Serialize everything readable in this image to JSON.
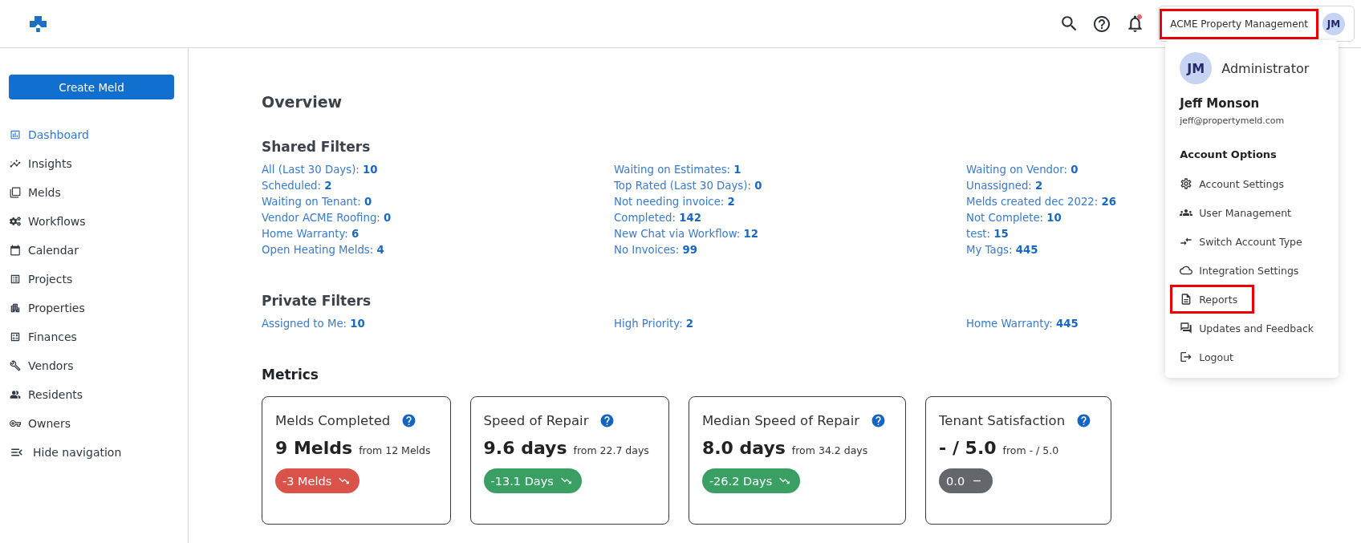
{
  "header": {
    "notifications_unread": true,
    "account": {
      "name": "ACME Property Management",
      "highlighted": true,
      "avatar_initials": "JM"
    }
  },
  "sidebar": {
    "create_button": "Create Meld",
    "items": [
      {
        "label": "Dashboard",
        "selected": true
      },
      {
        "label": "Insights",
        "selected": false
      },
      {
        "label": "Melds",
        "selected": false
      },
      {
        "label": "Workflows",
        "selected": false
      },
      {
        "label": "Calendar",
        "selected": false
      },
      {
        "label": "Projects",
        "selected": false
      },
      {
        "label": "Properties",
        "selected": false
      },
      {
        "label": "Finances",
        "selected": false
      },
      {
        "label": "Vendors",
        "selected": false
      },
      {
        "label": "Residents",
        "selected": false
      },
      {
        "label": "Owners",
        "selected": false
      }
    ],
    "hide_navigation": "Hide navigation"
  },
  "overview": {
    "title": "Overview",
    "sections": [
      {
        "title": "Shared Filters",
        "columns": [
          [
            {
              "text": "All (Last 30 Days): **10**"
            },
            {
              "text": "Scheduled: **2**"
            },
            {
              "text": "Waiting on Tenant: **0**"
            },
            {
              "text": "Vendor ACME Roofing: **0**"
            },
            {
              "text": "Home Warranty: **6**"
            },
            {
              "text": "Open Heating Melds: **4**"
            }
          ],
          [
            {
              "text": "Waiting on Estimates: **1**"
            },
            {
              "text": "Top Rated (Last 30 Days): **0**"
            },
            {
              "text": "Not needing invoice: **2**"
            },
            {
              "text": "Completed: **142**"
            },
            {
              "text": "New Chat via Workflow: **12**"
            },
            {
              "text": "No Invoices: **99**"
            }
          ],
          [
            {
              "text": "Waiting on Vendor: **0**"
            },
            {
              "text": "Unassigned: **2**"
            },
            {
              "text": "Melds created dec 2022: **26**"
            },
            {
              "text": "Not Complete: **10**"
            },
            {
              "text": "test: **15**"
            },
            {
              "text": "My Tags: **445**"
            }
          ]
        ]
      },
      {
        "title": "Private Filters",
        "columns": [
          [
            {
              "text": "Assigned to Me: **10**"
            }
          ],
          [
            {
              "text": "High Priority: **2**"
            }
          ],
          [
            {
              "text": "Home Warranty: **445**"
            }
          ]
        ]
      }
    ]
  },
  "metrics": {
    "title": "Metrics",
    "cards": [
      {
        "title": "Melds Completed",
        "value": "9 Melds",
        "baseline": "from 12 Melds",
        "change": "-3 Melds",
        "color": "#d9534b",
        "kind": "decrease"
      },
      {
        "title": "Speed of Repair",
        "value": "9.6 days",
        "baseline": "from 22.7 days",
        "change": "-13.1 Days",
        "color": "#3a9f62",
        "kind": "decrease"
      },
      {
        "title": "Median Speed of Repair",
        "value": "8.0 days",
        "baseline": "from 34.2 days",
        "change": "-26.2 Days",
        "color": "#3a9f62",
        "kind": "decrease"
      },
      {
        "title": "Tenant Satisfaction",
        "value": "- / 5.0",
        "baseline": "from - / 5.0",
        "change": "0.0",
        "color": "#63676c",
        "kind": "unchanged"
      }
    ]
  },
  "account_menu": {
    "avatar_initials": "JM",
    "role": "Administrator",
    "name": "Jeff Monson",
    "email": "jeff@propertymeld.com",
    "section_title": "Account Options",
    "items": [
      {
        "label": "Account Settings",
        "highlighted": false
      },
      {
        "label": "User Management",
        "highlighted": false
      },
      {
        "label": "Switch Account Type",
        "highlighted": false
      },
      {
        "label": "Integration Settings",
        "highlighted": false
      },
      {
        "label": "Reports",
        "highlighted": true
      },
      {
        "label": "Updates and Feedback",
        "highlighted": false
      },
      {
        "label": "Logout",
        "highlighted": false
      }
    ]
  }
}
